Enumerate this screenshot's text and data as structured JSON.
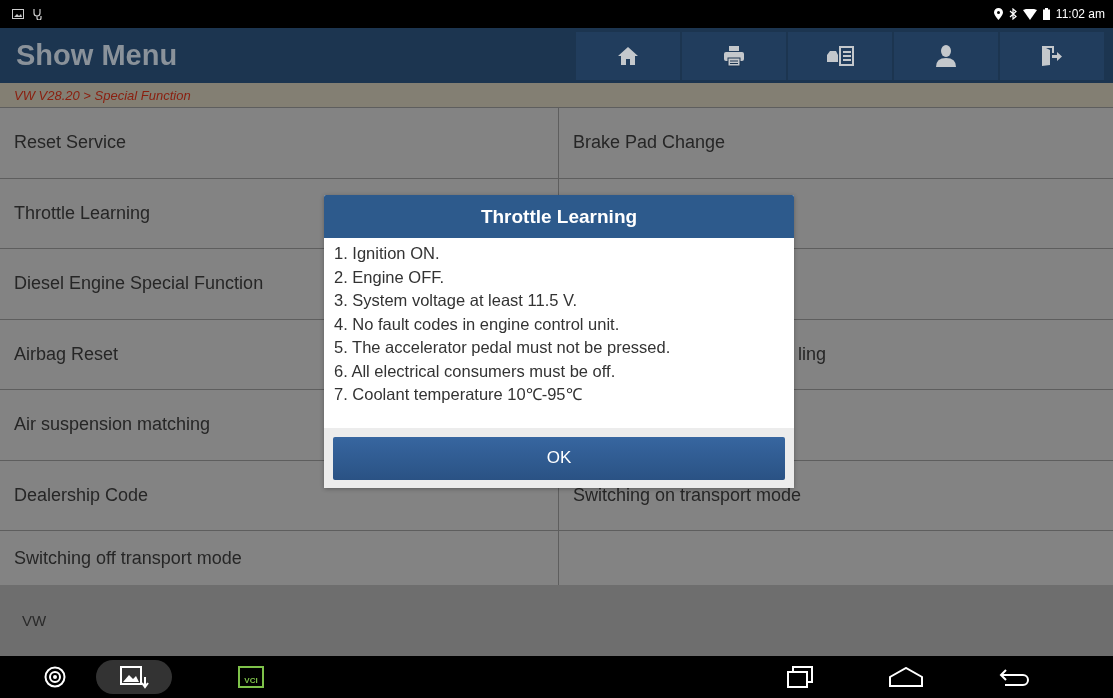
{
  "status_bar": {
    "time": "11:02 am"
  },
  "header": {
    "title": "Show Menu"
  },
  "breadcrumb": "VW V28.20 > Special Function",
  "menu_rows": [
    {
      "left": "Reset Service",
      "right": "Brake Pad Change"
    },
    {
      "left": "Throttle Learning"
    },
    {
      "left": "Diesel Engine Special Function"
    },
    {
      "left": "Airbag Reset",
      "right": "ling",
      "right_partly_hidden": true
    },
    {
      "left": "Air suspension matching"
    },
    {
      "left": "Dealership Code",
      "right": "Switching on transport mode"
    },
    {
      "left": "Switching off transport mode"
    }
  ],
  "footer": {
    "label": "VW"
  },
  "dialog": {
    "title": "Throttle Learning",
    "lines": [
      "1. Ignition ON.",
      "2. Engine OFF.",
      "3. System voltage at least 11.5 V.",
      "4. No fault codes in engine control unit.",
      "5. The accelerator pedal must not be pressed.",
      "6. All electrical consumers must be off.",
      "7. Coolant temperature 10℃-95℃"
    ],
    "button": "OK"
  },
  "nav_bar": {
    "vci_label": "VCI"
  }
}
